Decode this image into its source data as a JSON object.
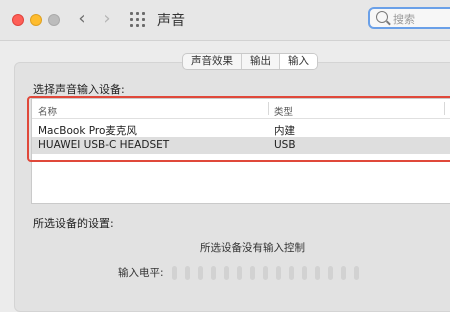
{
  "window": {
    "title": "声音"
  },
  "search": {
    "placeholder": "搜索"
  },
  "tabs": [
    {
      "label": "声音效果",
      "active": false
    },
    {
      "label": "输出",
      "active": false
    },
    {
      "label": "输入",
      "active": true
    }
  ],
  "input_section": {
    "title": "选择声音输入设备:",
    "columns": {
      "name": "名称",
      "type": "类型"
    },
    "devices": [
      {
        "name": "MacBook Pro麦克风",
        "type": "内建",
        "selected": false
      },
      {
        "name": "HUAWEI USB-C HEADSET",
        "type": "USB",
        "selected": true
      }
    ]
  },
  "settings_section": {
    "title": "所选设备的设置:",
    "message": "所选设备没有输入控制",
    "input_level_label": "输入电平:",
    "input_level": 0
  },
  "colors": {
    "highlight_border": "#e0483a",
    "search_focus": "#6aa0e8",
    "close": "#fe5f57",
    "minimize": "#febc2e"
  }
}
